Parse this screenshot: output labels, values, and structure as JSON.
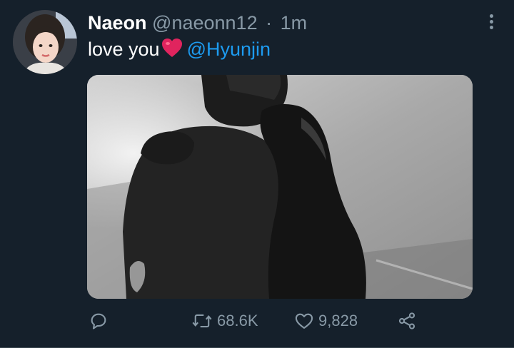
{
  "tweet": {
    "display_name": "Naeon",
    "handle": "@naeonn12",
    "separator": "·",
    "time": "1m",
    "text": "love you",
    "emoji": "heart-emoji",
    "mention": "@Hyunjin"
  },
  "actions": {
    "reply_icon": "reply-icon",
    "retweet_icon": "retweet-icon",
    "retweet_count": "68.6K",
    "like_icon": "heart-icon",
    "like_count": "9,828",
    "share_icon": "share-icon"
  },
  "colors": {
    "background": "#15202b",
    "secondary_text": "#8899a6",
    "link": "#1d9bf0",
    "primary_text": "#ffffff"
  }
}
